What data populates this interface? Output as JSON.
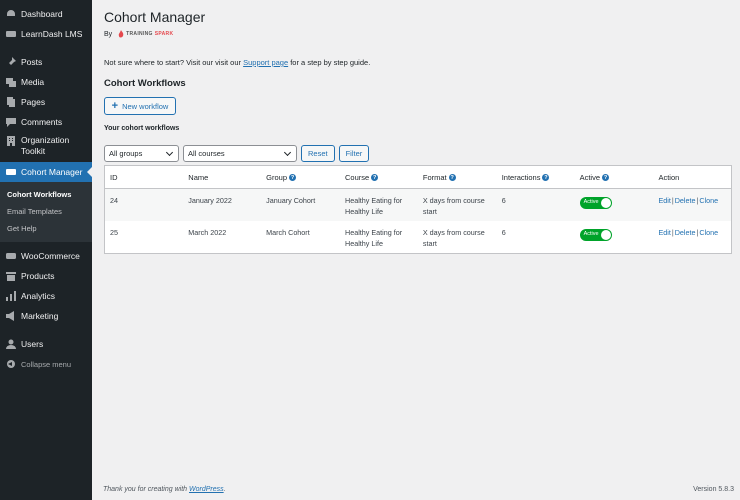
{
  "sidebar": {
    "dashboard": "Dashboard",
    "learndash": "LearnDash LMS",
    "posts": "Posts",
    "media": "Media",
    "pages": "Pages",
    "comments": "Comments",
    "org_toolkit": "Organization Toolkit",
    "cohort_manager": "Cohort Manager",
    "sub": [
      "Cohort Workflows",
      "Email Templates",
      "Get Help"
    ],
    "woocommerce": "WooCommerce",
    "products": "Products",
    "analytics": "Analytics",
    "marketing": "Marketing",
    "users": "Users",
    "collapse": "Collapse menu"
  },
  "page": {
    "title": "Cohort Manager",
    "by": "By",
    "logo_part1": "TRAINING",
    "logo_part2": "SPARK",
    "intro_before": "Not sure where to start? Visit our visit our ",
    "intro_link": "Support page",
    "intro_after": " for a step by step guide.",
    "section_title": "Cohort Workflows",
    "new_button": "New workflow",
    "list_title": "Your cohort workflows"
  },
  "filters": {
    "groups": "All groups",
    "courses": "All courses",
    "reset": "Reset",
    "filter": "Filter"
  },
  "table": {
    "headers": [
      "ID",
      "Name",
      "Group",
      "Course",
      "Format",
      "Interactions",
      "Active",
      "Action"
    ],
    "rows": [
      {
        "id": "24",
        "name": "January 2022",
        "group": "January Cohort",
        "course": "Healthy Eating for Healthy Life",
        "format": "X days from course start",
        "interactions": "6",
        "active": "Active"
      },
      {
        "id": "25",
        "name": "March 2022",
        "group": "March Cohort",
        "course": "Healthy Eating for Healthy Life",
        "format": "X days from course start",
        "interactions": "6",
        "active": "Active"
      }
    ],
    "action_labels": {
      "edit": "Edit",
      "delete": "Delete",
      "clone": "Clone",
      "sep": "|"
    }
  },
  "footer": {
    "thanks_before": "Thank you for creating with ",
    "thanks_link": "WordPress",
    "thanks_after": ".",
    "version": "Version 5.8.3"
  },
  "colors": {
    "accent": "#2271b1",
    "sidebar": "#1d2327",
    "toggle_on": "#00a32a",
    "brand_red": "#e5484d"
  }
}
